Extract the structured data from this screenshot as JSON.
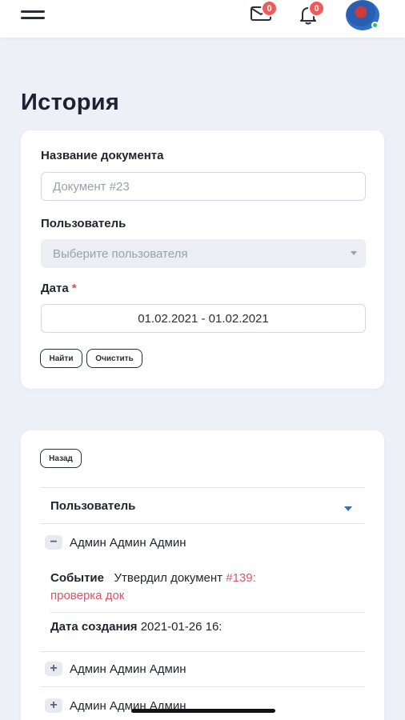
{
  "header": {
    "mail_badge": "0",
    "bell_badge": "0"
  },
  "page": {
    "title": "История"
  },
  "filter": {
    "doc_name_label": "Название документа",
    "doc_name_placeholder": "Документ #23",
    "user_label": "Пользователь",
    "user_placeholder": "Выберите пользователя",
    "date_label": "Дата",
    "date_required_mark": "*",
    "date_value": "01.02.2021 - 01.02.2021",
    "find_label": "Найти",
    "clear_label": "Очистить"
  },
  "list": {
    "back_label": "Назад",
    "column_header": "Пользователь",
    "rows": [
      {
        "toggle": "−",
        "name": "Админ Админ Админ"
      },
      {
        "toggle": "+",
        "name": "Админ Админ Админ"
      },
      {
        "toggle": "+",
        "name": "Админ Админ Админ"
      }
    ],
    "detail": {
      "event_label": "Событие",
      "event_text": "Утвердил документ",
      "event_link": "#139:",
      "event_link_2": "проверка док",
      "created_label": "Дата создания",
      "created_value": "2021-01-26 16:"
    }
  },
  "colors": {
    "accent": "#2f6fc9",
    "badge": "#ef5a5a",
    "link": "#d85566",
    "background": "#eef0f8"
  },
  "icons": [
    "menu-icon",
    "mail-icon",
    "bell-icon",
    "avatar",
    "caret-down-icon",
    "minus-icon",
    "plus-icon"
  ]
}
